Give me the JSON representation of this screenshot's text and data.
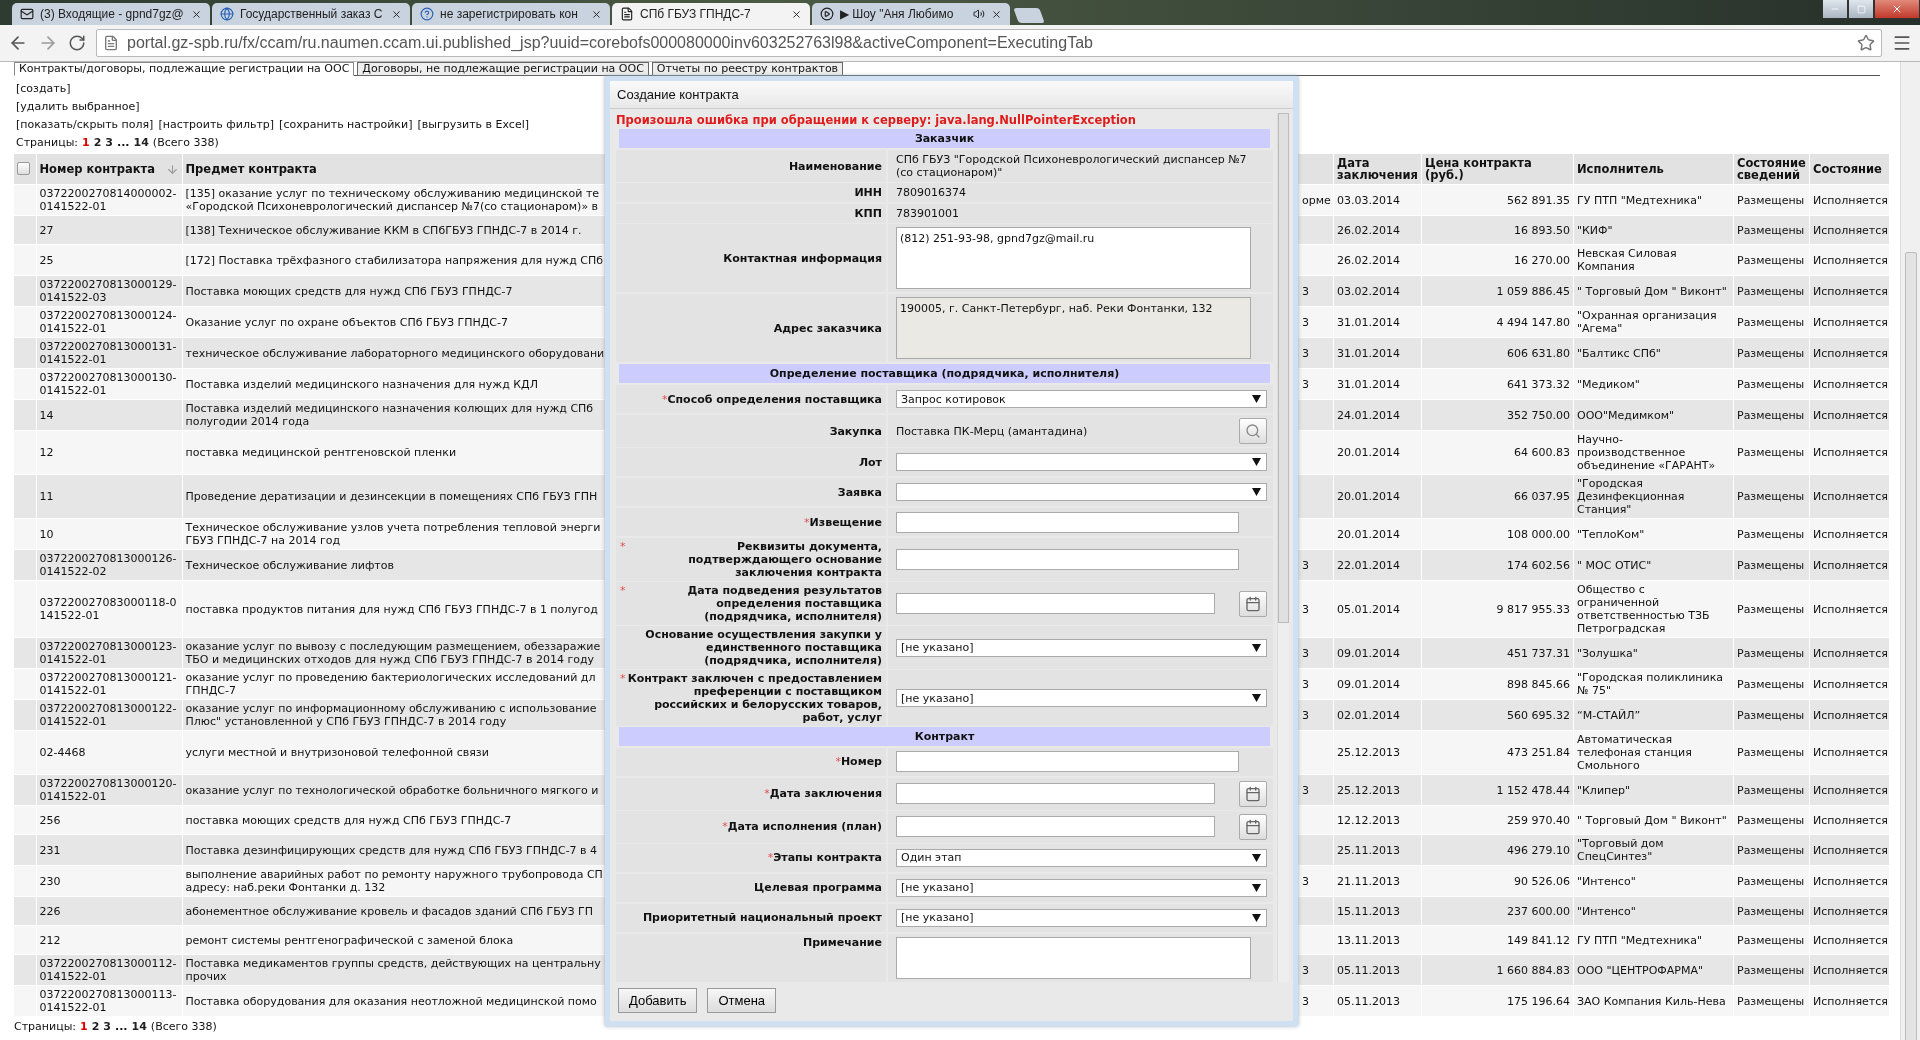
{
  "browser": {
    "tabs": [
      {
        "title": "(3) Входящие - gpnd7gz@",
        "selected": false
      },
      {
        "title": "Государственный заказ С",
        "selected": false
      },
      {
        "title": "не зарегистрировать кон",
        "selected": false
      },
      {
        "title": "СПб ГБУЗ ГПНДС-7",
        "selected": true
      },
      {
        "title": "▶ Шоу \"Аня Любимо",
        "selected": false,
        "playing_sound": true
      }
    ],
    "url": "portal.gz-spb.ru/fx/ccam/ru.naumen.ccam.ui.published_jsp?uuid=corebofs000080000inv603252763l98&activeComponent=ExecutingTab"
  },
  "page_tabs": [
    {
      "label": "Контракты/договоры, подлежащие регистрации на ООС",
      "selected": true
    },
    {
      "label": "Договоры, не подлежащие регистрации на ООС",
      "selected": false
    },
    {
      "label": "Отчеты по реестру контрактов",
      "selected": false
    }
  ],
  "actions": [
    "[создать]",
    "[удалить выбранное]"
  ],
  "toolbar_links": [
    "[показать/скрыть поля]",
    "[настроить фильтр]",
    "[сохранить настройки]",
    "[выгрузить в Excel]"
  ],
  "pager_top": {
    "label": "Страницы:",
    "pages": [
      {
        "label": "1",
        "selected": true
      },
      {
        "label": "2",
        "selected": false
      },
      {
        "label": "3",
        "selected": false
      }
    ],
    "ellipsis": "...",
    "last_page": "14",
    "total": "(Всего 338)"
  },
  "table": {
    "select_all": {
      "checked": false
    },
    "columns": [
      {
        "label": "Номер контракта",
        "sorted": true
      },
      {
        "label": "Предмет контракта",
        "sorted": false
      },
      {
        "label": "Дата заключения",
        "sorted": false
      },
      {
        "label": "Цена контракта (руб.)",
        "sorted": false
      },
      {
        "label": "Исполнитель",
        "sorted": false
      },
      {
        "label": "Состояние сведений",
        "sorted": false
      },
      {
        "label": "Состояние",
        "sorted": false
      }
    ],
    "rows": [
      {
        "number": "0372200270814000002-0141522-01",
        "subject": "[135] оказание услуг по техническому обслуживанию медицинской те\n«Городской Психоневрологический диспансер №7(со стационаром)» в",
        "column_3": "орме",
        "date": "03.03.2014",
        "price": "562 891.35",
        "executor": "ГУ ПТП \"Медтехника\"",
        "status": "Размещены",
        "state": "Исполняется"
      },
      {
        "number": "27",
        "subject": "[138] Техническое обслуживание ККМ в СПбГБУЗ ГПНДС-7 в 2014 г.",
        "date": "26.02.2014",
        "price": "16 893.50",
        "executor": "\"КИФ\"",
        "status": "Размещены",
        "state": "Исполняется"
      },
      {
        "number": "25",
        "subject": "[172] Поставка трёхфазного стабилизатора напряжения для нужд СПб",
        "date": "26.02.2014",
        "price": "16 270.00",
        "executor": "Невская Силовая Компания",
        "status": "Размещены",
        "state": "Исполняется"
      },
      {
        "number": "0372200270813000129-0141522-03",
        "subject": "Поставка моющих средств для нужд СПб ГБУЗ ГПНДС-7",
        "column_3": "3",
        "date": "03.02.2014",
        "price": "1 059 886.45",
        "executor": "\" Торговый Дом \" Виконт\"",
        "status": "Размещены",
        "state": "Исполняется"
      },
      {
        "number": "0372200270813000124-0141522-01",
        "subject": "Оказание услуг по охране объектов СПб ГБУЗ ГПНДС-7",
        "column_3": "3",
        "date": "31.01.2014",
        "price": "4 494 147.80",
        "executor": "\"Охранная организация \"Агема\"",
        "status": "Размещены",
        "state": "Исполняется"
      },
      {
        "number": "0372200270813000131-0141522-01",
        "subject": "техническое обслуживание лабораторного медицинского оборудовани",
        "column_3": "3",
        "date": "31.01.2014",
        "price": "606 631.80",
        "executor": "\"Балтикс СПб\"",
        "status": "Размещены",
        "state": "Исполняется"
      },
      {
        "number": "0372200270813000130-0141522-01",
        "subject": "Поставка изделий медицинского назначения для нужд КДЛ",
        "column_3": "3",
        "date": "31.01.2014",
        "price": "641 373.32",
        "executor": "\"Медиком\"",
        "status": "Размещены",
        "state": "Исполняется"
      },
      {
        "number": "14",
        "subject": "Поставка изделий медицинского назначения колющих для нужд СПб\nполугодии 2014 года",
        "date": "24.01.2014",
        "price": "352 750.00",
        "executor": "ООО\"Медимком\"",
        "status": "Размещены",
        "state": "Исполняется"
      },
      {
        "number": "12",
        "subject": "поставка медицинской рентгеновской пленки",
        "date": "20.01.2014",
        "price": "64 600.83",
        "executor": "Научно-производственное объединение «ГАРАНТ»",
        "status": "Размещены",
        "state": "Исполняется"
      },
      {
        "number": "11",
        "subject": "Проведение дератизации и дезинсекции в помещениях СПб ГБУЗ ГПН",
        "date": "20.01.2014",
        "price": "66 037.95",
        "executor": "\"Городская Дезинфекционная Станция\"",
        "status": "Размещены",
        "state": "Исполняется"
      },
      {
        "number": "10",
        "subject": "Техническое обслуживание узлов учета потребления тепловой энерги\nГБУЗ ГПНДС-7 на 2014 год",
        "date": "20.01.2014",
        "price": "108 000.00",
        "executor": "\"ТеплоКом\"",
        "status": "Размещены",
        "state": "Исполняется"
      },
      {
        "number": "0372200270813000126-0141522-02",
        "subject": "Техническое обслуживание лифтов",
        "column_3": "3",
        "date": "22.01.2014",
        "price": "174 602.56",
        "executor": "\" МОС ОТИС\"",
        "status": "Размещены",
        "state": "Исполняется"
      },
      {
        "number": "037220027083000118-0141522-01",
        "subject": "поставка продуктов питания для нужд СПб ГБУЗ ГПНДС-7 в 1 полугод",
        "column_3": "3",
        "date": "05.01.2014",
        "price": "9 817 955.33",
        "executor": "Общество с ограниченной ответственностью ТЗБ Петроградская",
        "status": "Размещены",
        "state": "Исполняется"
      },
      {
        "number": "0372200270813000123-0141522-01",
        "subject": "оказание услуг по вывозу с последующим размещением, обеззаражие\nТБО и медицинских отходов для нужд СПб ГБУЗ ГПНДС-7 в 2014 году",
        "column_3": "3",
        "date": "09.01.2014",
        "price": "451 737.31",
        "executor": "\"Золушка\"",
        "status": "Размещены",
        "state": "Исполняется"
      },
      {
        "number": "0372200270813000121-0141522-01",
        "subject": "оказание услуг по проведению бактериологических исследований дл\nГПНДС-7",
        "column_3": "3",
        "date": "09.01.2014",
        "price": "898 845.66",
        "executor": "\"Городская поликлиника № 75\"",
        "status": "Размещены",
        "state": "Исполняется"
      },
      {
        "number": "0372200270813000122-0141522-01",
        "subject": "оказание услуг по информационному обслуживанию с использование\nПлюс\" установленной у СПб ГБУЗ ГПНДС-7 в 2014 году",
        "column_3": "3",
        "date": "02.01.2014",
        "price": "560 695.32",
        "executor": "“М-СТАЙЛ”",
        "status": "Размещены",
        "state": "Исполняется"
      },
      {
        "number": "02-4468",
        "subject": "услуги местной и внутризоновой телефонной связи",
        "date": "25.12.2013",
        "price": "473 251.84",
        "executor": "Автоматическая телефоная станция Смольного",
        "status": "Размещены",
        "state": "Исполняется"
      },
      {
        "number": "0372200270813000120-0141522-01",
        "subject": "оказание услуг по технологической обработке больничного мягкого и",
        "column_3": "3",
        "date": "25.12.2013",
        "price": "1 152 478.44",
        "executor": "\"Клипер\"",
        "status": "Размещены",
        "state": "Исполняется"
      },
      {
        "number": "256",
        "subject": "поставка моющих средств для нужд СПб ГБУЗ ГПНДС-7",
        "date": "12.12.2013",
        "price": "259 970.40",
        "executor": "\" Торговый Дом \" Виконт\"",
        "status": "Размещены",
        "state": "Исполняется"
      },
      {
        "number": "231",
        "subject": "Поставка дезинфицирующих средств для нужд СПб ГБУЗ ГПНДС-7 в 4",
        "date": "25.11.2013",
        "price": "496 279.10",
        "executor": "\"Торговый дом СпецСинтез\"",
        "status": "Размещены",
        "state": "Исполняется"
      },
      {
        "number": "230",
        "subject": "выполнение аварийных работ по ремонту наружного трубопровода СП\nадресу: наб.реки Фонтанки д. 132",
        "column_3": "3",
        "date": "21.11.2013",
        "price": "90 526.06",
        "executor": "\"Интенсо\"",
        "status": "Размещены",
        "state": "Исполняется"
      },
      {
        "number": "226",
        "subject": "абонементное обслуживание кровель и фасадов зданий СПб ГБУЗ ГП",
        "date": "15.11.2013",
        "price": "237 600.00",
        "executor": "\"Интенсо\"",
        "status": "Размещены",
        "state": "Исполняется"
      },
      {
        "number": "212",
        "subject": "ремонт системы рентгенографической с заменой блока",
        "date": "13.11.2013",
        "price": "149 841.12",
        "executor": "ГУ ПТП \"Медтехника\"",
        "status": "Размещены",
        "state": "Исполняется"
      },
      {
        "number": "0372200270813000112-0141522-01",
        "subject": "Поставка медикаментов группы средств, действующих на центральну\nпрочих",
        "column_3": "3",
        "date": "05.11.2013",
        "price": "1 660 884.83",
        "executor": "ООО \"ЦЕНТРОФАРМА\"",
        "status": "Размещены",
        "state": "Исполняется"
      },
      {
        "number": "0372200270813000113-0141522-01",
        "subject": "Поставка оборудования для оказания неотложной медицинской помо",
        "column_3": "3",
        "date": "05.11.2013",
        "price": "175 196.64",
        "executor": "ЗАО Компания Киль-Нева",
        "status": "Размещены",
        "state": "Исполняется"
      }
    ]
  },
  "pager_bottom": {
    "label": "Страницы:",
    "pages": [
      {
        "label": "1",
        "selected": true
      },
      {
        "label": "2",
        "selected": false
      },
      {
        "label": "3",
        "selected": false
      }
    ],
    "ellipsis": "...",
    "last_page": "14",
    "total": "(Всего 338)"
  },
  "dialog": {
    "title": "Создание контракта",
    "required_mark": "*",
    "error": "Произошла ошибка при обращении к серверу: java.lang.NullPointerException",
    "sections": [
      {
        "title": "Заказчик",
        "rows": [
          {
            "label": "Наименование",
            "required": false,
            "kind": "text",
            "value": "СПб ГБУЗ \"Городской Психоневрологический диспансер №7 (со стационаром)\""
          },
          {
            "label": "ИНН",
            "required": false,
            "kind": "text",
            "value": "7809016374"
          },
          {
            "label": "КПП",
            "required": false,
            "kind": "text",
            "value": "783901001"
          },
          {
            "label": "Контактная информация",
            "required": false,
            "kind": "textarea",
            "readonly": false,
            "value": "(812) 251-93-98, gpnd7gz@mail.ru"
          },
          {
            "label": "Адрес заказчика",
            "required": false,
            "kind": "textarea",
            "readonly": true,
            "value": "190005, г. Санкт-Петербург, наб. Реки Фонтанки, 132"
          }
        ]
      },
      {
        "title": "Определение поставщика (подрядчика, исполнителя)",
        "rows": [
          {
            "label": "Способ определения поставщика",
            "required": true,
            "kind": "select",
            "value": "Запрос котировок"
          },
          {
            "label": "Закупка",
            "required": false,
            "kind": "lookup",
            "value": "Поставка ПК-Мерц (амантадина)"
          },
          {
            "label": "Лот",
            "required": false,
            "kind": "select"
          },
          {
            "label": "Заявка",
            "required": false,
            "kind": "select"
          },
          {
            "label": "Извещение",
            "required": true,
            "kind": "input"
          },
          {
            "label": "Реквизиты документа, подтверждающего основание заключения контракта",
            "required": true,
            "kind": "input"
          },
          {
            "label": "Дата подведения результатов определения поставщика (подрядчика, исполнителя)",
            "required": true,
            "kind": "date"
          },
          {
            "label": "Основание осуществления закупки у единственного поставщика (подрядчика, исполнителя)",
            "required": false,
            "kind": "select",
            "value": "[не указано]"
          },
          {
            "label": "Контракт заключен с предоставлением преференции с поставщиком российских и белорусских товаров, работ, услуг",
            "required": true,
            "kind": "select",
            "value": "[не указано]"
          }
        ]
      },
      {
        "title": "Контракт",
        "rows": [
          {
            "label": "Номер",
            "required": true,
            "kind": "input"
          },
          {
            "label": "Дата заключения",
            "required": true,
            "kind": "date"
          },
          {
            "label": "Дата исполнения (план)",
            "required": true,
            "kind": "date"
          },
          {
            "label": "Этапы контракта",
            "required": true,
            "kind": "select",
            "value": "Один этап"
          },
          {
            "label": "Целевая программа",
            "required": false,
            "kind": "select",
            "value": "[не указано]"
          },
          {
            "label": "Приоритетный национальный проект",
            "required": false,
            "kind": "select",
            "value": "[не указано]"
          },
          {
            "label": "Примечание",
            "required": false,
            "kind": "textarea",
            "readonly": false
          }
        ]
      }
    ],
    "buttons": [
      "Добавить",
      "Отмена"
    ]
  }
}
